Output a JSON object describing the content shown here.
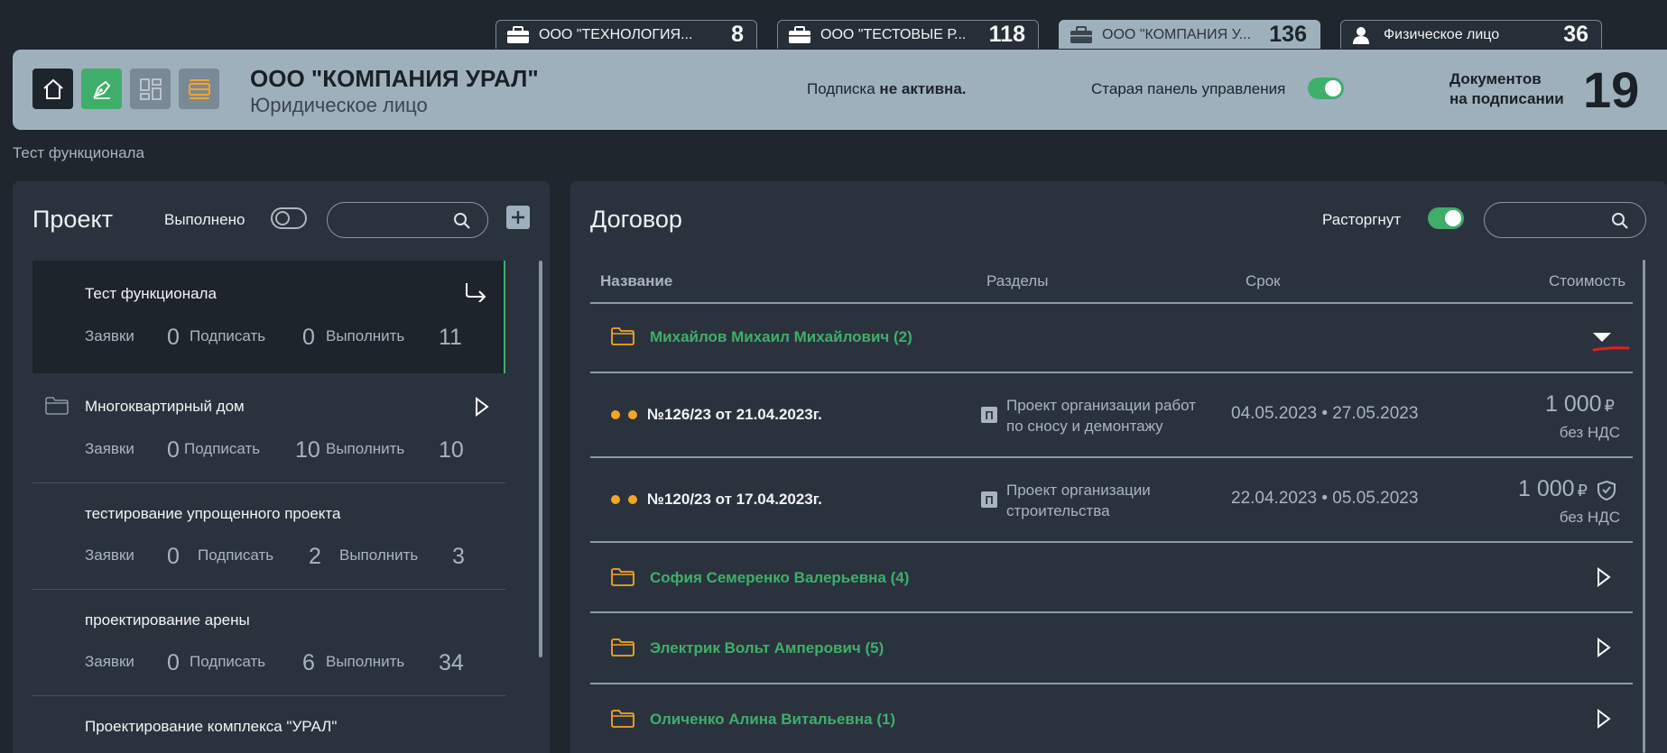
{
  "tabs": [
    {
      "name": "ООО \"ТЕХНОЛОГИЯ...",
      "count": "8",
      "icon": "briefcase-icon"
    },
    {
      "name": "ООО \"ТЕСТОВЫЕ Р...",
      "count": "118",
      "icon": "briefcase-icon"
    },
    {
      "name": "ООО \"КОМПАНИЯ У...",
      "count": "136",
      "icon": "briefcase-icon",
      "active": true
    },
    {
      "name": "Физическое лицо",
      "count": "36",
      "icon": "person-icon"
    }
  ],
  "header": {
    "company_name": "ООО \"КОМПАНИЯ УРАЛ\"",
    "company_type": "Юридическое лицо",
    "subscription_prefix": "Подписка ",
    "subscription_status": "не активна.",
    "old_panel_label": "Старая панель управления",
    "docs_label_line1": "Документов",
    "docs_label_line2": "на подписании",
    "docs_count": "19"
  },
  "breadcrumb": "Тест функционала",
  "left_panel": {
    "title": "Проект",
    "done_label": "Выполнено",
    "search_placeholder": "",
    "projects": [
      {
        "name": "Тест функционала",
        "requests_label": "Заявки",
        "requests": "0",
        "sign_label": "Подписать",
        "sign": "0",
        "do_label": "Выполнить",
        "do": "11"
      },
      {
        "name": "Многоквартирный дом",
        "requests_label": "Заявки",
        "requests": "0",
        "sign_label": "Подписать",
        "sign": "10",
        "do_label": "Выполнить",
        "do": "10"
      },
      {
        "name": "тестирование упрощенного проекта",
        "requests_label": "Заявки",
        "requests": "0",
        "sign_label": "Подписать",
        "sign": "2",
        "do_label": "Выполнить",
        "do": "3"
      },
      {
        "name": "проектирование арены",
        "requests_label": "Заявки",
        "requests": "0",
        "sign_label": "Подписать",
        "sign": "6",
        "do_label": "Выполнить",
        "do": "34"
      },
      {
        "name": "Проектирование комплекса \"УРАЛ\""
      }
    ]
  },
  "right_panel": {
    "title": "Договор",
    "terminated_label": "Расторгнут",
    "search_placeholder": "",
    "columns": {
      "name": "Название",
      "sections": "Разделы",
      "term": "Срок",
      "cost": "Стоимость"
    },
    "groups": [
      {
        "name": "Михайлов Михаил Михайлович (2)",
        "expanded": true
      },
      {
        "name": "София Семеренко Валерьевна (4)"
      },
      {
        "name": "Электрик Вольт Амперович (5)"
      },
      {
        "name": "Оличенко Алина Витальевна (1)"
      }
    ],
    "contracts": [
      {
        "number": "№126/23 от 21.04.2023г.",
        "section_badge": "П",
        "section_line1": "Проект организации работ",
        "section_line2": "по сносу и демонтажу",
        "period": "04.05.2023 • 27.05.2023",
        "price": "1 000",
        "currency": "₽",
        "vat": "без НДС"
      },
      {
        "number": "№120/23 от 17.04.2023г.",
        "section_badge": "П",
        "section_line1": "Проект организации",
        "section_line2": "строительства",
        "period": "22.04.2023 • 05.05.2023",
        "price": "1 000",
        "currency": "₽",
        "vat": "без НДС"
      }
    ]
  },
  "colors": {
    "accent_green": "#3fae6b",
    "header_bg": "#9fb0bd",
    "folder_orange": "#f5a524",
    "annotation_red": "#e02020"
  }
}
